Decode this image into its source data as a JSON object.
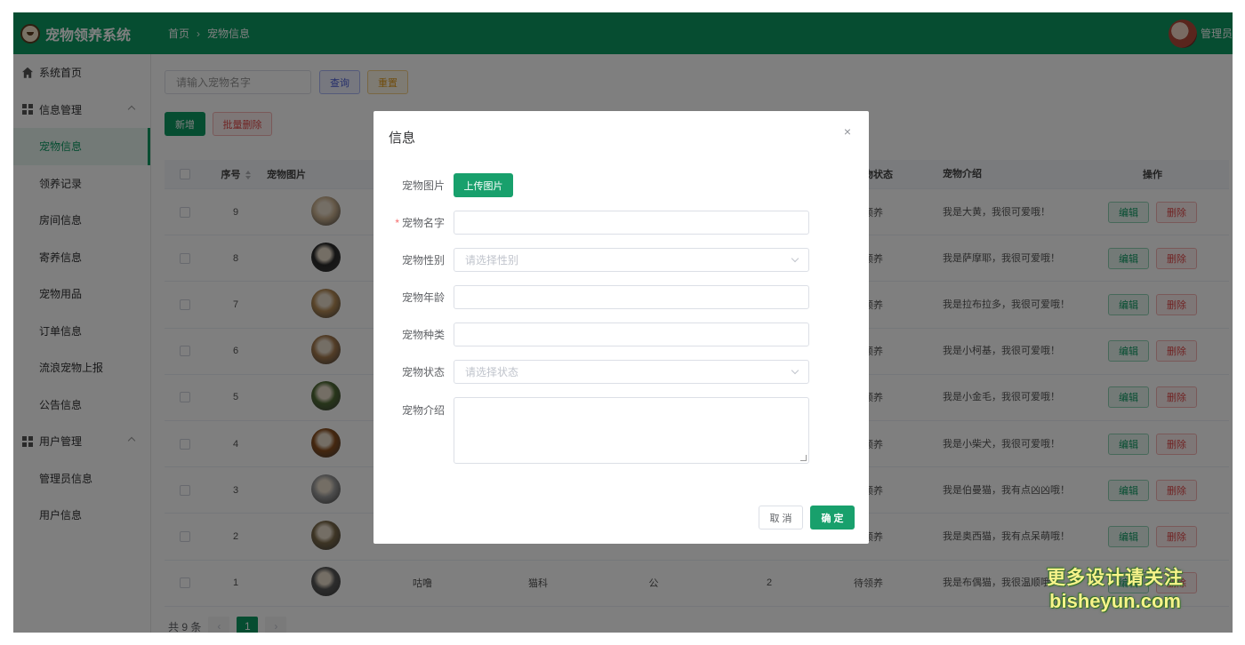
{
  "app": {
    "title": "宠物领养系统",
    "user": "管理员"
  },
  "breadcrumb": {
    "home": "首页",
    "sep": "›",
    "current": "宠物信息"
  },
  "sidebar": {
    "home": "系统首页",
    "groups": [
      {
        "label": "信息管理",
        "items": [
          "宠物信息",
          "领养记录",
          "房间信息",
          "寄养信息",
          "宠物用品",
          "订单信息",
          "流浪宠物上报",
          "公告信息"
        ]
      },
      {
        "label": "用户管理",
        "items": [
          "管理员信息",
          "用户信息"
        ]
      }
    ],
    "active_item": "宠物信息"
  },
  "toolbar": {
    "search_placeholder": "请输入宠物名字",
    "query": "查询",
    "reset": "重置",
    "add": "新增",
    "batch_delete": "批量删除"
  },
  "table": {
    "headers": {
      "index": "序号",
      "image": "宠物图片",
      "status": "宠物状态",
      "intro": "宠物介绍",
      "ops": "操作"
    },
    "rows": [
      {
        "index": "9",
        "status": "已领养",
        "intro": "我是大黄，我很可爱哦！",
        "pet_color": "#c9b08f"
      },
      {
        "index": "8",
        "status": "已领养",
        "intro": "我是萨摩耶，我很可爱哦！",
        "pet_color": "#2a2a2a"
      },
      {
        "index": "7",
        "status": "已领养",
        "intro": "我是拉布拉多，我很可爱哦！",
        "pet_color": "#b48a55"
      },
      {
        "index": "6",
        "status": "待领养",
        "intro": "我是小柯基，我很可爱哦！",
        "pet_color": "#a57a4e"
      },
      {
        "index": "5",
        "status": "待领养",
        "intro": "我是小金毛，我很可爱哦！",
        "pet_color": "#4f6b35"
      },
      {
        "index": "4",
        "status": "待领养",
        "intro": "我是小柴犬，我很可爱哦！",
        "pet_color": "#8a4f1f"
      },
      {
        "index": "3",
        "status": "待领养",
        "intro": "我是伯曼猫，我有点凶凶哦！",
        "pet_color": "#9a9a9a"
      },
      {
        "index": "2",
        "status": "已领养",
        "intro": "我是奥西猫，我有点呆萌哦！",
        "pet_color": "#7b6a4a"
      },
      {
        "index": "1",
        "name": "咕噜",
        "category": "猫科",
        "gender": "公",
        "age": "2",
        "status": "待领养",
        "intro": "我是布偶猫，我很温顺哦！",
        "pet_color": "#585858"
      }
    ],
    "edit_label": "编辑",
    "delete_label": "删除"
  },
  "pager": {
    "total": "共 9 条",
    "prev": "‹",
    "current": "1",
    "next": "›"
  },
  "modal": {
    "title": "信息",
    "close": "×",
    "fields": {
      "image_label": "宠物图片",
      "upload_label": "上传图片",
      "name_label": "宠物名字",
      "gender_label": "宠物性别",
      "gender_placeholder": "请选择性别",
      "age_label": "宠物年龄",
      "kind_label": "宠物种类",
      "status_label": "宠物状态",
      "status_placeholder": "请选择状态",
      "intro_label": "宠物介绍"
    },
    "cancel": "取 消",
    "ok": "确 定"
  },
  "watermark": {
    "line1": "更多设计请关注",
    "line2": "bisheyun.com"
  },
  "colors": {
    "brand": "#0d9a63",
    "danger": "#e04848",
    "warning": "#e09b1d",
    "query": "#4a5dd6"
  }
}
